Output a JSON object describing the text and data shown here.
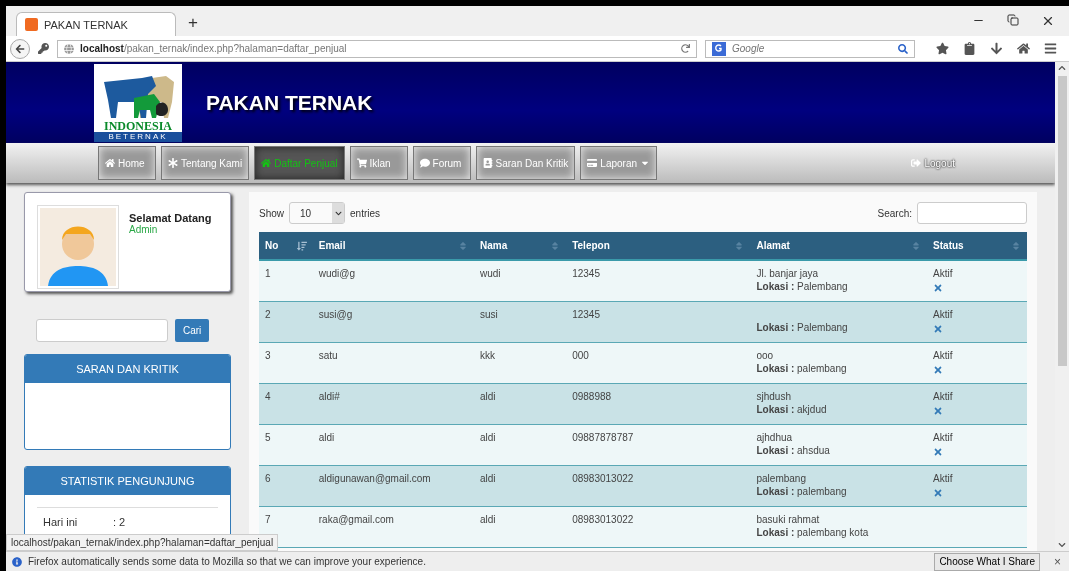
{
  "browser": {
    "tab_title": "PAKAN TERNAK",
    "new_tab": "+",
    "url": "**localhost**/pakan_ternak/index.php?halaman=daftar_penjual",
    "search_placeholder": "Google"
  },
  "header": {
    "logo_text": "INDONESIA",
    "logo_subtext": "BETERNAK",
    "title": "PAKAN TERNAK"
  },
  "nav": [
    {
      "label": "Home",
      "selected": false
    },
    {
      "label": "Tentang Kami",
      "selected": false
    },
    {
      "label": "Daftar Penjual",
      "selected": true
    },
    {
      "label": "Iklan",
      "selected": false
    },
    {
      "label": "Forum",
      "selected": false
    },
    {
      "label": "Saran Dan Kritik",
      "selected": false
    },
    {
      "label": "Laporan",
      "selected": false,
      "has_menu": true
    }
  ],
  "logout": "Logout",
  "sidebar": {
    "welcome": "Selamat Datang",
    "role": "Admin",
    "search_button": "Cari",
    "panels": [
      {
        "title": "SARAN DAN KRITIK"
      },
      {
        "title": "STATISTIK PENGUNJUNG",
        "rows": [
          {
            "label": "Hari ini",
            "value": ": 2"
          }
        ]
      }
    ]
  },
  "table": {
    "show_label": "Show",
    "page_size": "10",
    "entries_label": "entries",
    "search_label": "Search:",
    "columns": [
      {
        "label": "No",
        "sorted": true
      },
      {
        "label": "Email",
        "sorted": false
      },
      {
        "label": "Nama",
        "sorted": false
      },
      {
        "label": "Telepon",
        "sorted": false
      },
      {
        "label": "Alamat",
        "sorted": false
      },
      {
        "label": "Status",
        "sorted": false
      }
    ],
    "rows": [
      {
        "no": "1",
        "email": "wudi@g",
        "nama": "wudi",
        "telepon": "12345",
        "alamat": "Jl. banjar jaya",
        "lokasi": "**Lokasi :** Palembang",
        "status": "Aktif"
      },
      {
        "no": "2",
        "email": "susi@g",
        "nama": "susi",
        "telepon": "12345",
        "lokasi": "**Lokasi :** Palembang",
        "status": "Aktif"
      },
      {
        "no": "3",
        "email": "satu",
        "nama": "kkk",
        "telepon": "000",
        "alamat": "ooo",
        "lokasi": "**Lokasi :** palembang",
        "status": "Aktif"
      },
      {
        "no": "4",
        "email": "aldi#",
        "nama": "aldi",
        "telepon": "0988988",
        "alamat": "sjhdush",
        "lokasi": "**Lokasi :** akjdud",
        "status": "Aktif"
      },
      {
        "no": "5",
        "email": "aldi",
        "nama": "aldi",
        "telepon": "09887878787",
        "alamat": "ajhdhua",
        "lokasi": "**Lokasi :** ahsdua",
        "status": "Aktif"
      },
      {
        "no": "6",
        "email": "aldigunawan@gmail.com",
        "nama": "aldi",
        "telepon": "08983013022",
        "alamat": "palembang",
        "lokasi": "**Lokasi :** palembang",
        "status": "Aktif"
      },
      {
        "no": "7",
        "email": "raka@gmail.com",
        "nama": "aldi",
        "telepon": "08983013022",
        "alamat": "basuki rahmat",
        "lokasi": "**Lokasi :** palembang kota"
      }
    ]
  },
  "status_url": "localhost/pakan_ternak/index.php?halaman=daftar_penjual",
  "notification": {
    "message": "Firefox automatically sends some data to Mozilla so that we can improve your experience.",
    "button": "Choose What I Share",
    "close": "×"
  }
}
